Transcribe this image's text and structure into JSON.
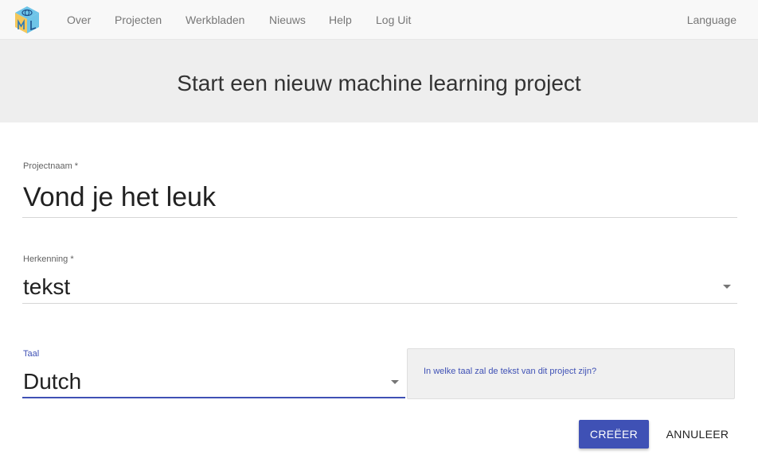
{
  "nav": {
    "items": [
      "Over",
      "Projecten",
      "Werkbladen",
      "Nieuws",
      "Help",
      "Log Uit"
    ],
    "language": "Language"
  },
  "header": {
    "title": "Start een nieuw machine learning project"
  },
  "form": {
    "project_name": {
      "label": "Projectnaam *",
      "value": "Vond je het leuk"
    },
    "recognition": {
      "label": "Herkenning *",
      "value": "tekst"
    },
    "language": {
      "label": "Taal",
      "value": "Dutch",
      "hint": "In welke taal zal de tekst van dit project zijn?"
    }
  },
  "actions": {
    "create": "CREËER",
    "cancel": "ANNULEER"
  },
  "colors": {
    "accent": "#3f51b5",
    "navbar": "#f8f8f8",
    "header": "#eeeeee"
  }
}
